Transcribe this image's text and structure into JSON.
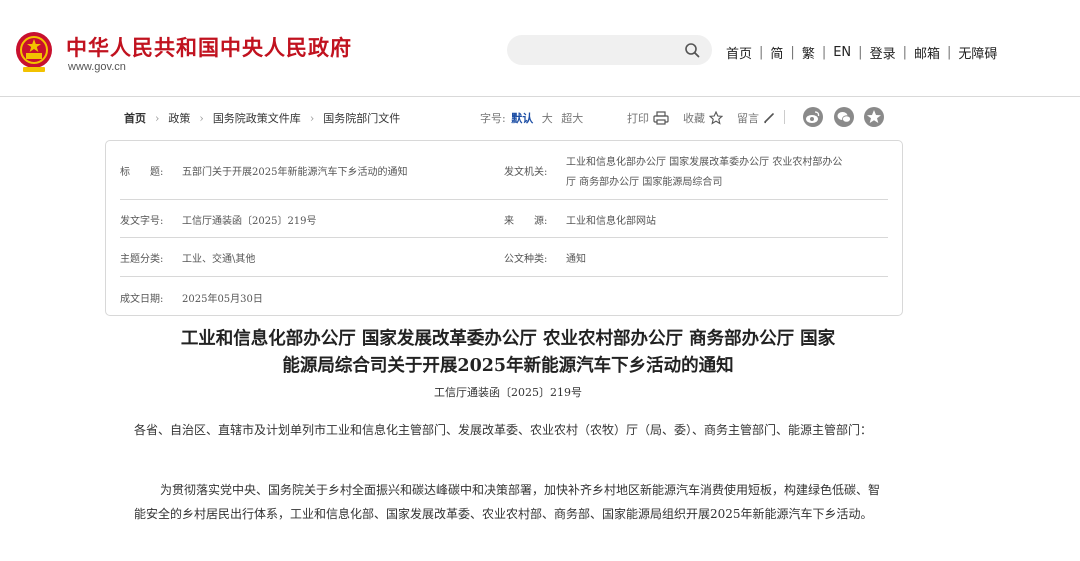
{
  "header": {
    "site_name": "中华人民共和国中央人民政府",
    "site_url": "www.gov.cn",
    "nav": [
      "首页",
      "简",
      "繁",
      "EN",
      "登录",
      "邮箱",
      "无障碍"
    ],
    "search_placeholder": ""
  },
  "breadcrumb": [
    "首页",
    "政策",
    "国务院政策文件库",
    "国务院部门文件"
  ],
  "font_size": {
    "label": "字号:",
    "options": [
      "默认",
      "大",
      "超大"
    ],
    "selected": "默认"
  },
  "tools": {
    "print": "打印",
    "favorite": "收藏",
    "comment": "留言"
  },
  "share": [
    "weibo",
    "wechat",
    "qzone"
  ],
  "info": {
    "title_label": "标　　题:",
    "title_value": "五部门关于开展2025年新能源汽车下乡活动的通知",
    "issuer_label": "发文机关:",
    "issuer_value_line1": "工业和信息化部办公厅 国家发展改革委办公厅 农业农村部办公",
    "issuer_value_line2": "厅 商务部办公厅 国家能源局综合司",
    "docno_label": "发文字号:",
    "docno_value": "工信厅通装函〔2025〕219号",
    "source_label": "来　　源:",
    "source_value": "工业和信息化部网站",
    "subject_label": "主题分类:",
    "subject_value": "工业、交通\\其他",
    "type_label": "公文种类:",
    "type_value": "通知",
    "date_label": "成文日期:",
    "date_value": "2025年05月30日"
  },
  "article": {
    "title_line1": "工业和信息化部办公厅 国家发展改革委办公厅 农业农村部办公厅 商务部办公厅 国家",
    "title_line2": "能源局综合司关于开展2025年新能源汽车下乡活动的通知",
    "doc_number": "工信厅通装函〔2025〕219号",
    "para1": "各省、自治区、直辖市及计划单列市工业和信息化主管部门、发展改革委、农业农村（农牧）厅（局、委）、商务主管部门、能源主管部门：",
    "para2": "为贯彻落实党中央、国务院关于乡村全面振兴和碳达峰碳中和决策部署，加快补齐乡村地区新能源汽车消费使用短板，构建绿色低碳、智能安全的乡村居民出行体系，工业和信息化部、国家发展改革委、农业农村部、商务部、国家能源局组织开展2025年新能源汽车下乡活动。"
  },
  "colors": {
    "brand_red": "#c1121f",
    "accent_blue": "#1e4fa5"
  }
}
